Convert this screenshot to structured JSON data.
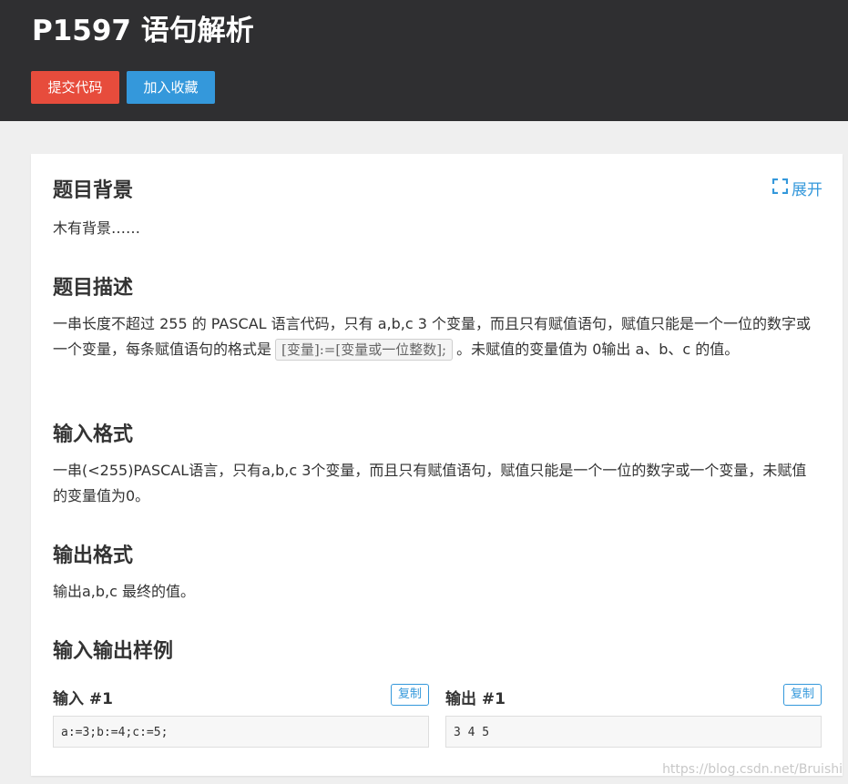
{
  "header": {
    "title": "P1597 语句解析",
    "submit_label": "提交代码",
    "favorite_label": "加入收藏"
  },
  "colors": {
    "header_bg": "#2f2f31",
    "submit": "#e74c3c",
    "favorite": "#3498db",
    "accent": "#3498db",
    "page_bg": "#efefef"
  },
  "background": {
    "title": "题目背景",
    "text": "木有背景……",
    "expand_label": "展开",
    "expand_icon": "expand-icon"
  },
  "description": {
    "title": "题目描述",
    "text_before": "一串长度不超过 255 的 PASCAL 语言代码，只有 a,b,c 3 个变量，而且只有赋值语句，赋值只能是一个一位的数字或一个变量，每条赋值语句的格式是",
    "code": "[变量]:=[变量或一位整数];",
    "text_after": "。未赋值的变量值为 0输出 a、b、c 的值。"
  },
  "input_format": {
    "title": "输入格式",
    "text": "一串(<255)PASCAL语言，只有a,b,c 3个变量，而且只有赋值语句，赋值只能是一个一位的数字或一个变量，未赋值的变量值为0。"
  },
  "output_format": {
    "title": "输出格式",
    "text": "输出a,b,c 最终的值。"
  },
  "samples": {
    "title": "输入输出样例",
    "input_label": "输入 #1",
    "output_label": "输出 #1",
    "copy_label": "复制",
    "input_value": "a:=3;b:=4;c:=5;",
    "output_value": "3 4 5"
  },
  "watermark": "https://blog.csdn.net/Bruishi"
}
